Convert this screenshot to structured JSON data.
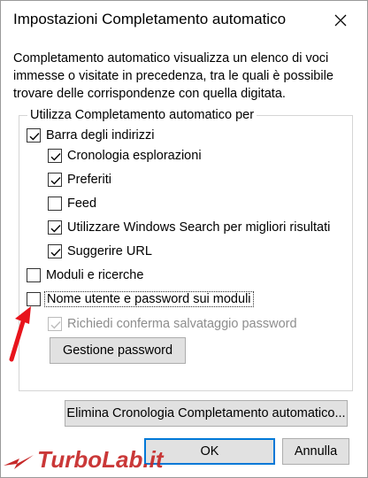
{
  "window": {
    "title": "Impostazioni Completamento automatico"
  },
  "description": "Completamento automatico visualizza un elenco di voci immesse o visitate in precedenza, tra le quali è possibile trovare delle corrispondenze con quella digitata.",
  "group": {
    "legend": "Utilizza Completamento automatico per",
    "items": [
      {
        "label": "Barra degli indirizzi",
        "checked": true
      },
      {
        "label": "Cronologia esplorazioni",
        "checked": true
      },
      {
        "label": "Preferiti",
        "checked": true
      },
      {
        "label": "Feed",
        "checked": false
      },
      {
        "label": "Utilizzare Windows Search per migliori risultati",
        "checked": true
      },
      {
        "label": "Suggerire URL",
        "checked": true
      },
      {
        "label": "Moduli e ricerche",
        "checked": false
      },
      {
        "label": "Nome utente e password sui moduli",
        "checked": false
      },
      {
        "label": "Richiedi conferma salvataggio password",
        "checked": true,
        "disabled": true
      }
    ],
    "manage_passwords_label": "Gestione password"
  },
  "buttons": {
    "delete_history": "Elimina Cronologia Completamento automatico...",
    "ok": "OK",
    "cancel": "Annulla"
  },
  "watermark": {
    "brand": "TurboLab.it"
  },
  "colors": {
    "accent": "#0078d7",
    "arrow": "#e8141c",
    "watermark": "#c62828"
  }
}
